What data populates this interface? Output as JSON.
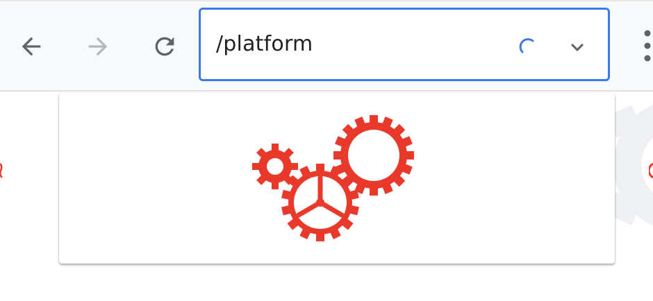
{
  "browser": {
    "address_text": "/platform",
    "loading": true,
    "accent_color": "#3b7be8",
    "icons": {
      "back": "arrow-left-icon",
      "forward": "arrow-right-icon",
      "reload": "reload-icon",
      "spinner": "loading-spinner-icon",
      "dropdown": "chevron-down-icon",
      "menu": "kebab-menu-icon"
    }
  },
  "page": {
    "card_image": "gears-logo",
    "brand_color": "#e8392b"
  }
}
